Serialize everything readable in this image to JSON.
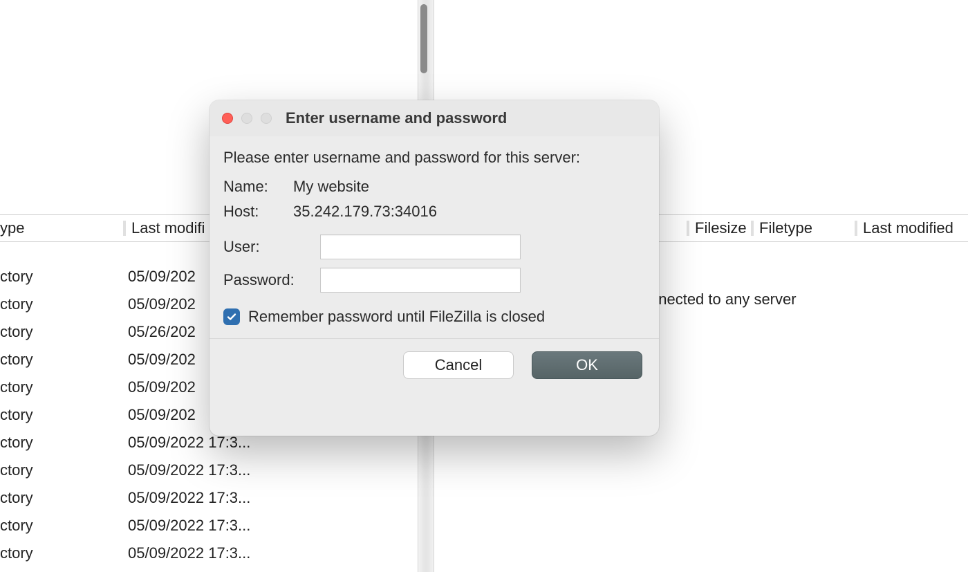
{
  "leftHeader": {
    "col1": "ype",
    "col2": "Last modifi"
  },
  "rightHeader": {
    "filesize": "Filesize",
    "filetype": "Filetype",
    "lastModified": "Last modified"
  },
  "rightPane": {
    "message": "Not connected to any server"
  },
  "files": [
    {
      "name": "ctory",
      "date": "05/09/202"
    },
    {
      "name": "ctory",
      "date": "05/09/202"
    },
    {
      "name": "ctory",
      "date": "05/26/202"
    },
    {
      "name": "ctory",
      "date": "05/09/202"
    },
    {
      "name": "ctory",
      "date": "05/09/202"
    },
    {
      "name": "ctory",
      "date": "05/09/202"
    },
    {
      "name": "ctory",
      "date": "05/09/2022 17:3..."
    },
    {
      "name": "ctory",
      "date": "05/09/2022 17:3..."
    },
    {
      "name": "ctory",
      "date": "05/09/2022 17:3..."
    },
    {
      "name": "ctory",
      "date": "05/09/2022 17:3..."
    },
    {
      "name": "ctory",
      "date": "05/09/2022 17:3..."
    }
  ],
  "dialog": {
    "title": "Enter username and password",
    "prompt": "Please enter username and password for this server:",
    "nameLabel": "Name:",
    "nameValue": "My website",
    "hostLabel": "Host:",
    "hostValue": "35.242.179.73:34016",
    "userLabel": "User:",
    "userValue": "",
    "passwordLabel": "Password:",
    "passwordValue": "",
    "rememberLabel": "Remember password until FileZilla is closed",
    "rememberChecked": true,
    "cancel": "Cancel",
    "ok": "OK"
  }
}
